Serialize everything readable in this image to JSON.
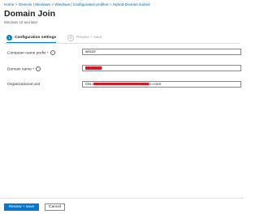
{
  "breadcrumb": [
    "Home",
    "Devices | Windows",
    "Windows | Configuration profiles",
    "Hybrid-Domain-Joined"
  ],
  "breadcrumb_separator": ">",
  "page": {
    "title": "Domain Join",
    "subtitle": "Windows 10 and later"
  },
  "tabs": [
    {
      "step": "1",
      "label": "Configuration settings",
      "state": "active"
    },
    {
      "step": "2",
      "label": "Review + save",
      "state": "inactive"
    }
  ],
  "form": {
    "computer_name_prefix": {
      "label": "Computer name prefix *",
      "value": "win10"
    },
    "domain_name": {
      "label": "Domain name *",
      "value_suffix": "ı"
    },
    "organizational_unit": {
      "label": "Organizational unit",
      "value_prefix": "OU=",
      "value_suffix": "C=com"
    }
  },
  "info_icon_glyph": "i",
  "footer": {
    "review_save_label": "Review + save",
    "cancel_label": "Cancel"
  },
  "colors": {
    "accent": "#0078d4",
    "link": "#0063b1",
    "redaction": "#e81123"
  }
}
